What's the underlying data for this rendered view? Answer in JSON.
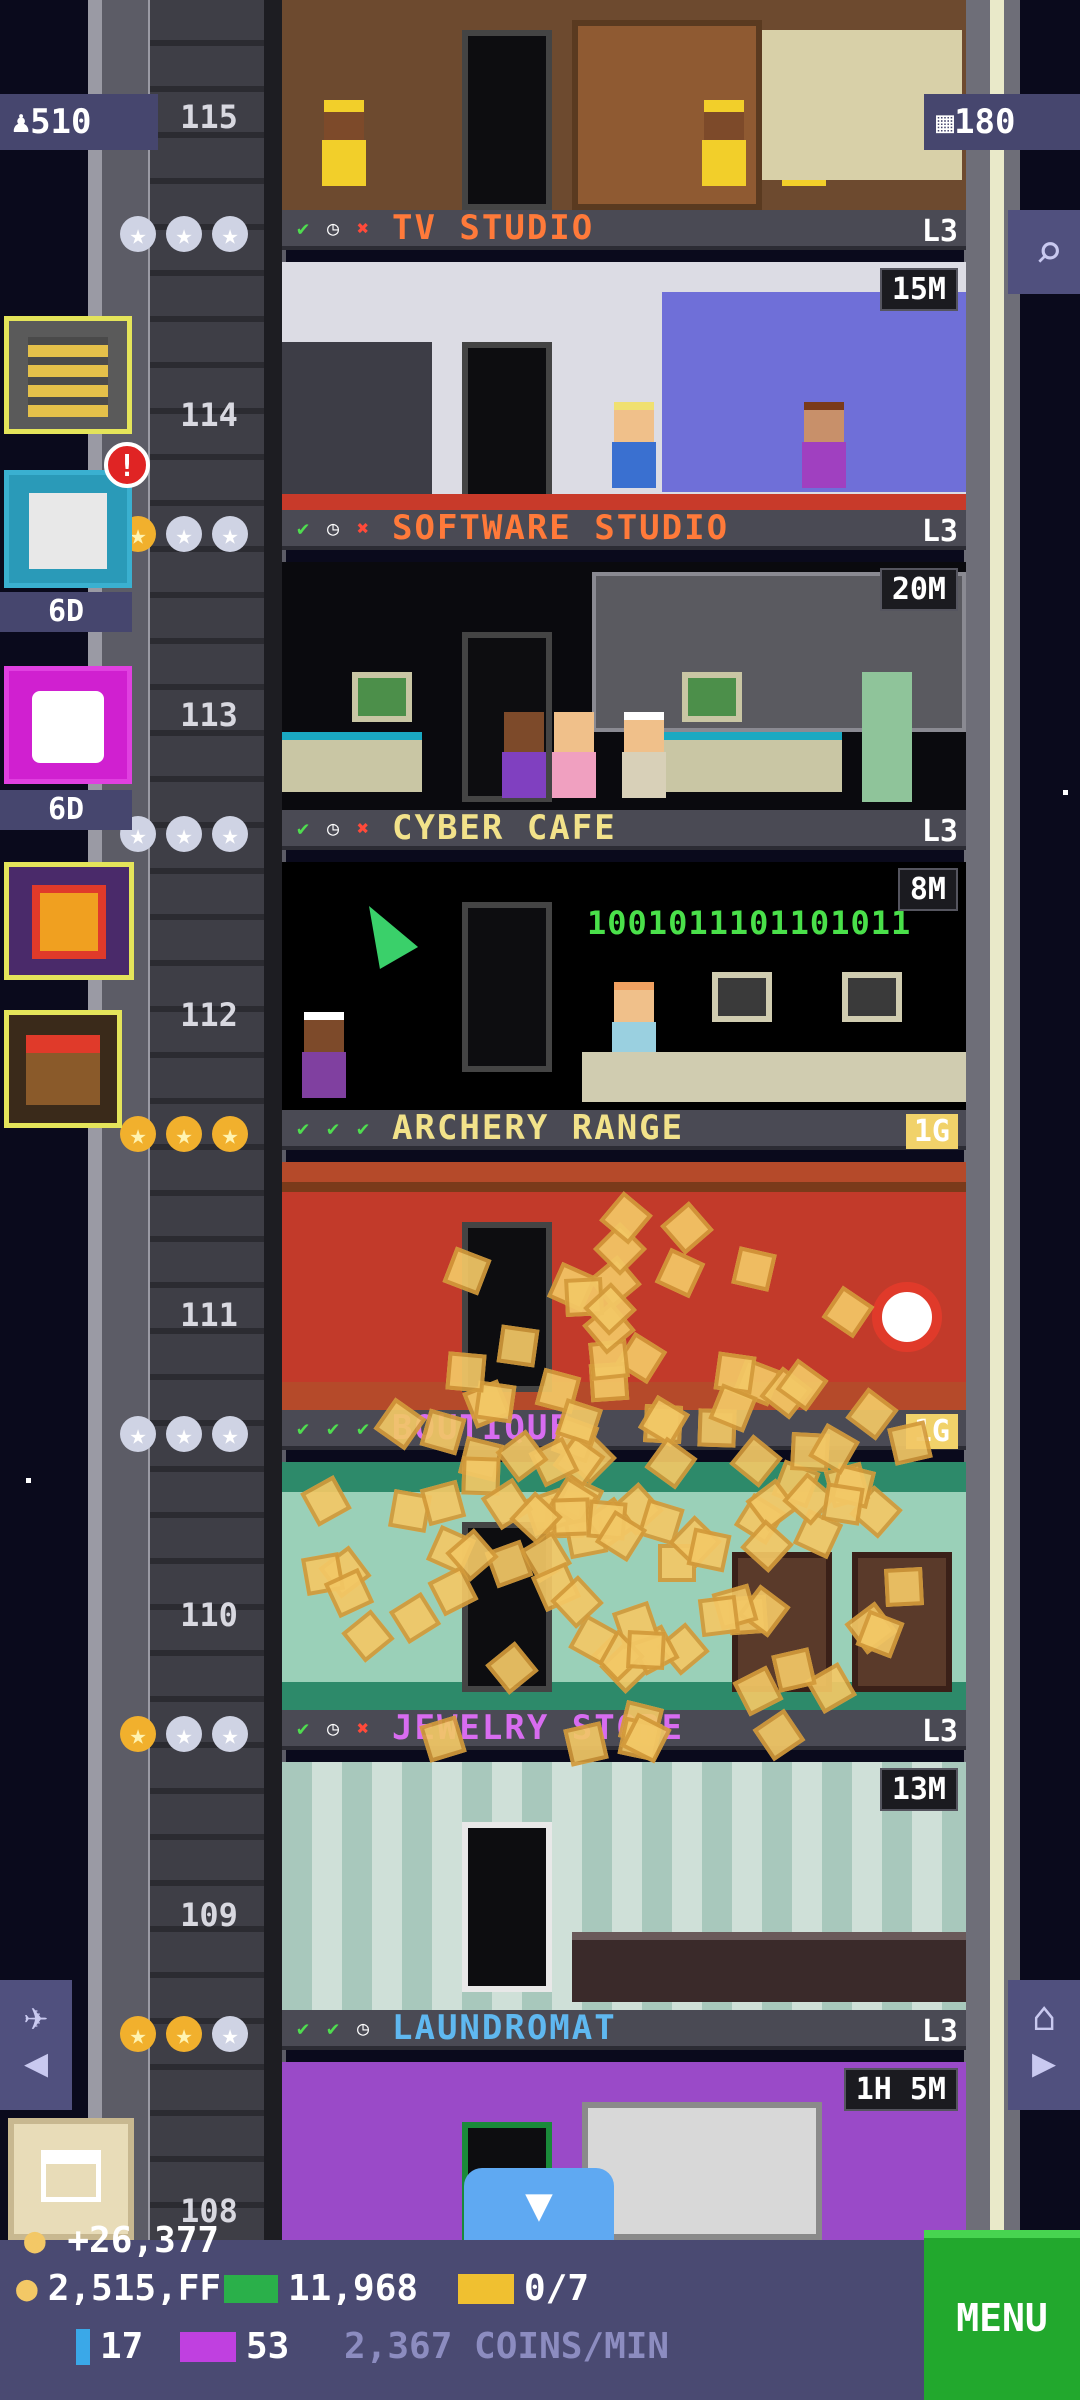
{
  "hud": {
    "population": "510",
    "floor_count": "180"
  },
  "side_buttons": [
    {
      "name": "floor-building-button",
      "label": ""
    },
    {
      "name": "quests-button",
      "label": "6D",
      "badge": "!"
    },
    {
      "name": "lucky-dice-button",
      "label": "6D"
    },
    {
      "name": "gift-button",
      "label": ""
    },
    {
      "name": "market-button",
      "label": ""
    }
  ],
  "floors": [
    {
      "number": "115",
      "name": "",
      "level": "",
      "timer": ""
    },
    {
      "number": "114",
      "name": "TV STUDIO",
      "level": "L3",
      "timer": "15M",
      "name_color": "#ff7a3a",
      "status": [
        "✔",
        "◷",
        "✖"
      ],
      "stars": [
        "silver",
        "silver",
        "silver"
      ]
    },
    {
      "number": "113",
      "name": "SOFTWARE STUDIO",
      "level": "L3",
      "timer": "20M",
      "name_color": "#ff7a3a",
      "status": [
        "✔",
        "◷",
        "✖"
      ],
      "stars": [
        "gold",
        "silver",
        "silver"
      ]
    },
    {
      "number": "112",
      "name": "CYBER CAFE",
      "level": "L3",
      "timer": "8M",
      "name_color": "#f2e28a",
      "status": [
        "✔",
        "◷",
        "✖"
      ],
      "stars": [
        "silver",
        "silver",
        "silver"
      ]
    },
    {
      "number": "111",
      "name": "ARCHERY RANGE",
      "level": "1G",
      "timer": "",
      "name_color": "#f2e28a",
      "status": [
        "✔",
        "✔",
        "✔"
      ],
      "stars": [
        "gold",
        "gold",
        "gold"
      ]
    },
    {
      "number": "110",
      "name": "BOUTIQUE",
      "level": "1G",
      "timer": "",
      "name_color": "#d86cf0",
      "status": [
        "✔",
        "✔",
        "✔"
      ],
      "stars": [
        "silver",
        "silver",
        "silver"
      ]
    },
    {
      "number": "109",
      "name": "JEWELRY STORE",
      "level": "L3",
      "timer": "13M",
      "name_color": "#d86cf0",
      "status": [
        "✔",
        "◷",
        "✖"
      ],
      "stars": [
        "gold",
        "silver",
        "silver"
      ]
    },
    {
      "number": "108",
      "name": "LAUNDROMAT",
      "level": "L3",
      "timer": "1H 5M",
      "name_color": "#5fb8f0",
      "status": [
        "✔",
        "✔",
        "◷"
      ],
      "stars": [
        "gold",
        "gold",
        "silver"
      ]
    }
  ],
  "room_text": {
    "cyber_binary": "1001011101101011"
  },
  "float_income": "+26,377",
  "bottom": {
    "coins": "2,515,FF",
    "bux": "11,968",
    "vip": "0/7",
    "cards": "17",
    "tickets": "53",
    "rate": "2,367 COINS/MIN",
    "menu_label": "MENU"
  },
  "icons": {
    "population": "person-icon",
    "floors": "building-icon",
    "search": "magnifier-icon",
    "elevator": "plane-icon",
    "home": "home-icon",
    "down": "down-arrow-icon"
  }
}
